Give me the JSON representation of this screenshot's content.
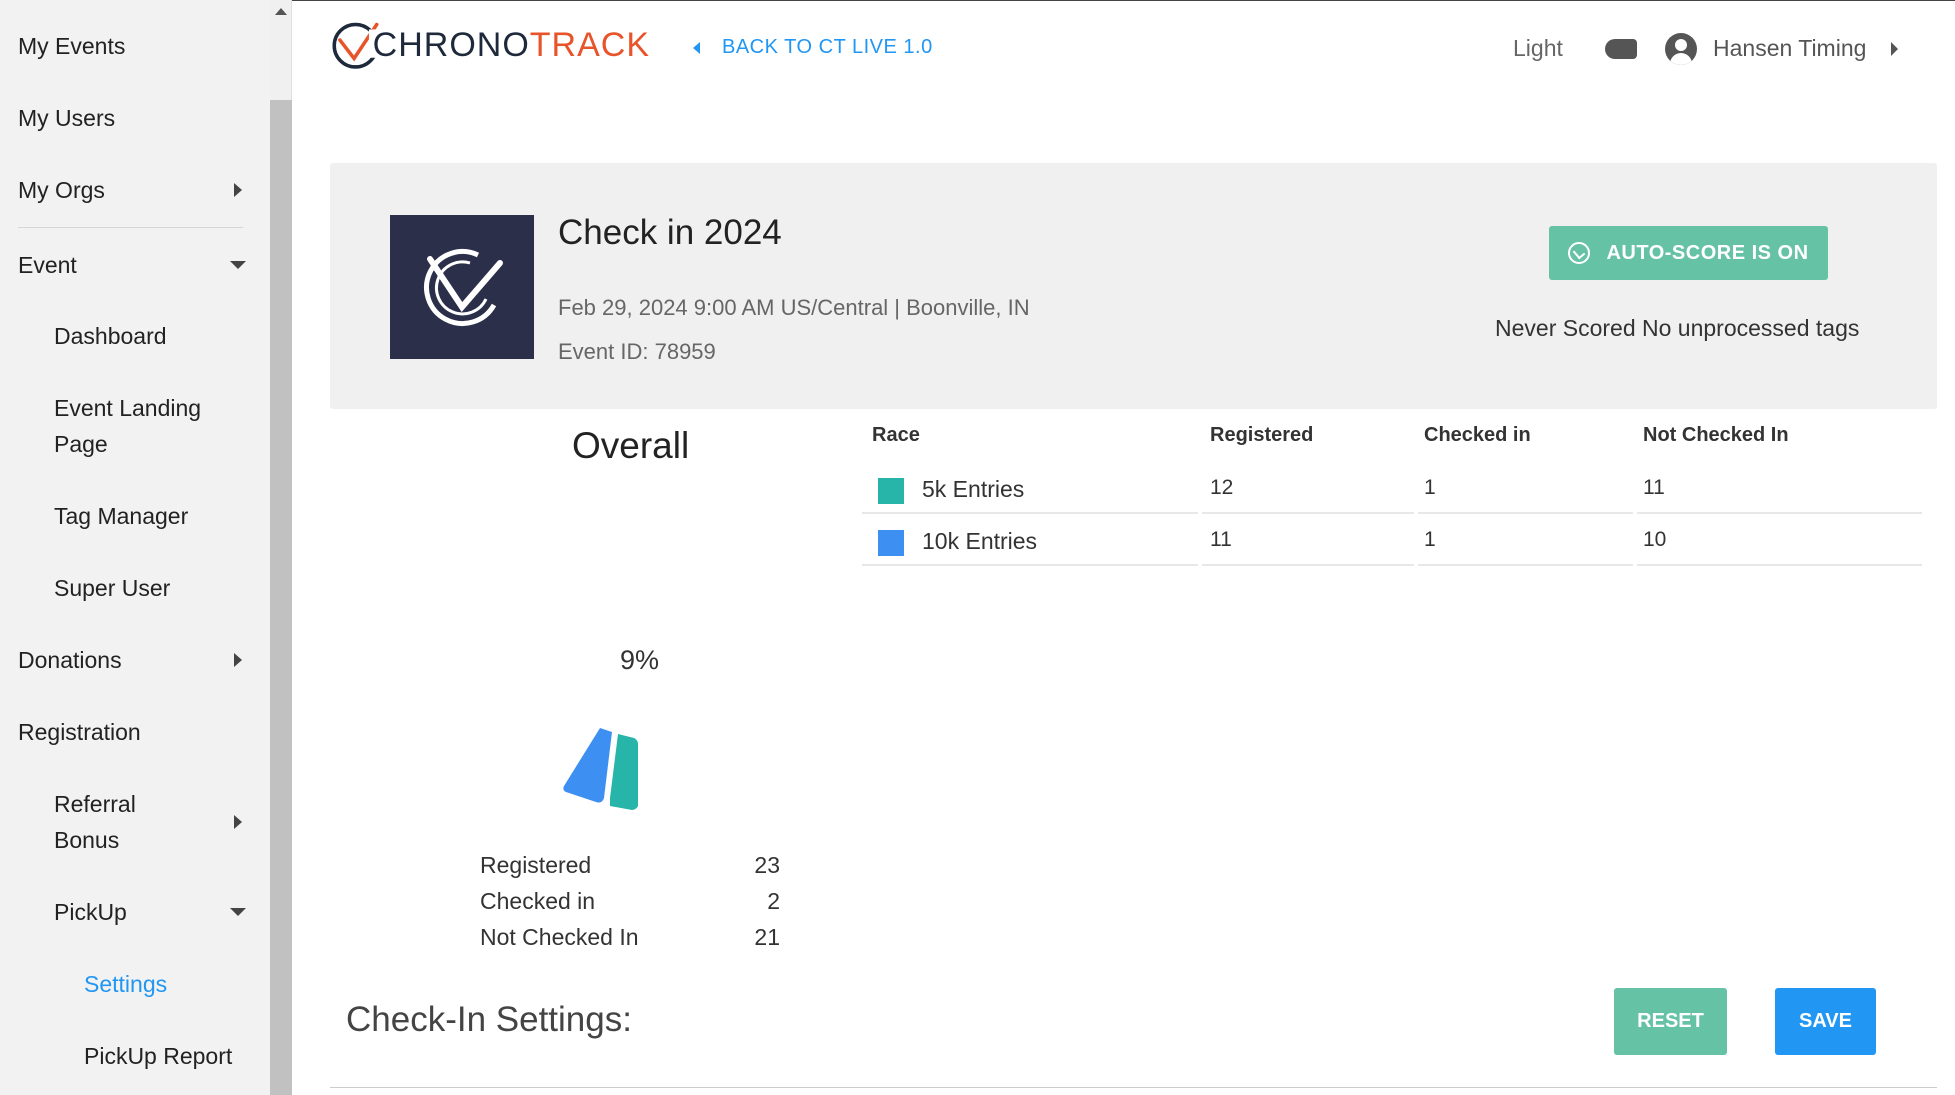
{
  "sidebar": {
    "items": [
      {
        "label": "My Events"
      },
      {
        "label": "My Users"
      },
      {
        "label": "My Orgs"
      },
      {
        "label": "Event"
      },
      {
        "label": "Dashboard"
      },
      {
        "label": "Event Landing Page"
      },
      {
        "label": "Tag Manager"
      },
      {
        "label": "Super User"
      },
      {
        "label": "Donations"
      },
      {
        "label": "Registration"
      },
      {
        "label": "Referral Bonus"
      },
      {
        "label": "PickUp"
      },
      {
        "label": "Settings"
      },
      {
        "label": "PickUp Report"
      }
    ],
    "active_color": "#2196f3"
  },
  "header": {
    "logo_chrono": "CHRONO",
    "logo_track": "TRACK",
    "back_link": "BACK TO CT LIVE 1.0",
    "theme_label": "Light",
    "user_name": "Hansen Timing"
  },
  "event": {
    "title": "Check in 2024",
    "meta": "Feb 29, 2024 9:00 AM US/Central | Boonville, IN",
    "event_id": "Event ID: 78959",
    "autoscore_label": "AUTO-SCORE IS ON",
    "scored_status": "Never Scored No unprocessed tags"
  },
  "overall": {
    "title": "Overall",
    "percent": "9%",
    "summary": [
      {
        "label": "Registered",
        "value": "23"
      },
      {
        "label": "Checked in",
        "value": "2"
      },
      {
        "label": "Not Checked In",
        "value": "21"
      }
    ]
  },
  "race_table": {
    "headers": [
      "Race",
      "Registered",
      "Checked in",
      "Not Checked In"
    ],
    "rows": [
      {
        "race": "5k Entries",
        "registered": "12",
        "checked_in": "1",
        "not_checked_in": "11",
        "color": "#26b5a8"
      },
      {
        "race": "10k Entries",
        "registered": "11",
        "checked_in": "1",
        "not_checked_in": "10",
        "color": "#3d8ff2"
      }
    ]
  },
  "settings": {
    "title": "Check-In Settings:",
    "reset_label": "RESET",
    "save_label": "SAVE"
  },
  "colors": {
    "accent_blue": "#2196f3",
    "accent_green": "#66c2a5",
    "brand_orange": "#e8542a",
    "brand_navy": "#1e2a3b"
  }
}
